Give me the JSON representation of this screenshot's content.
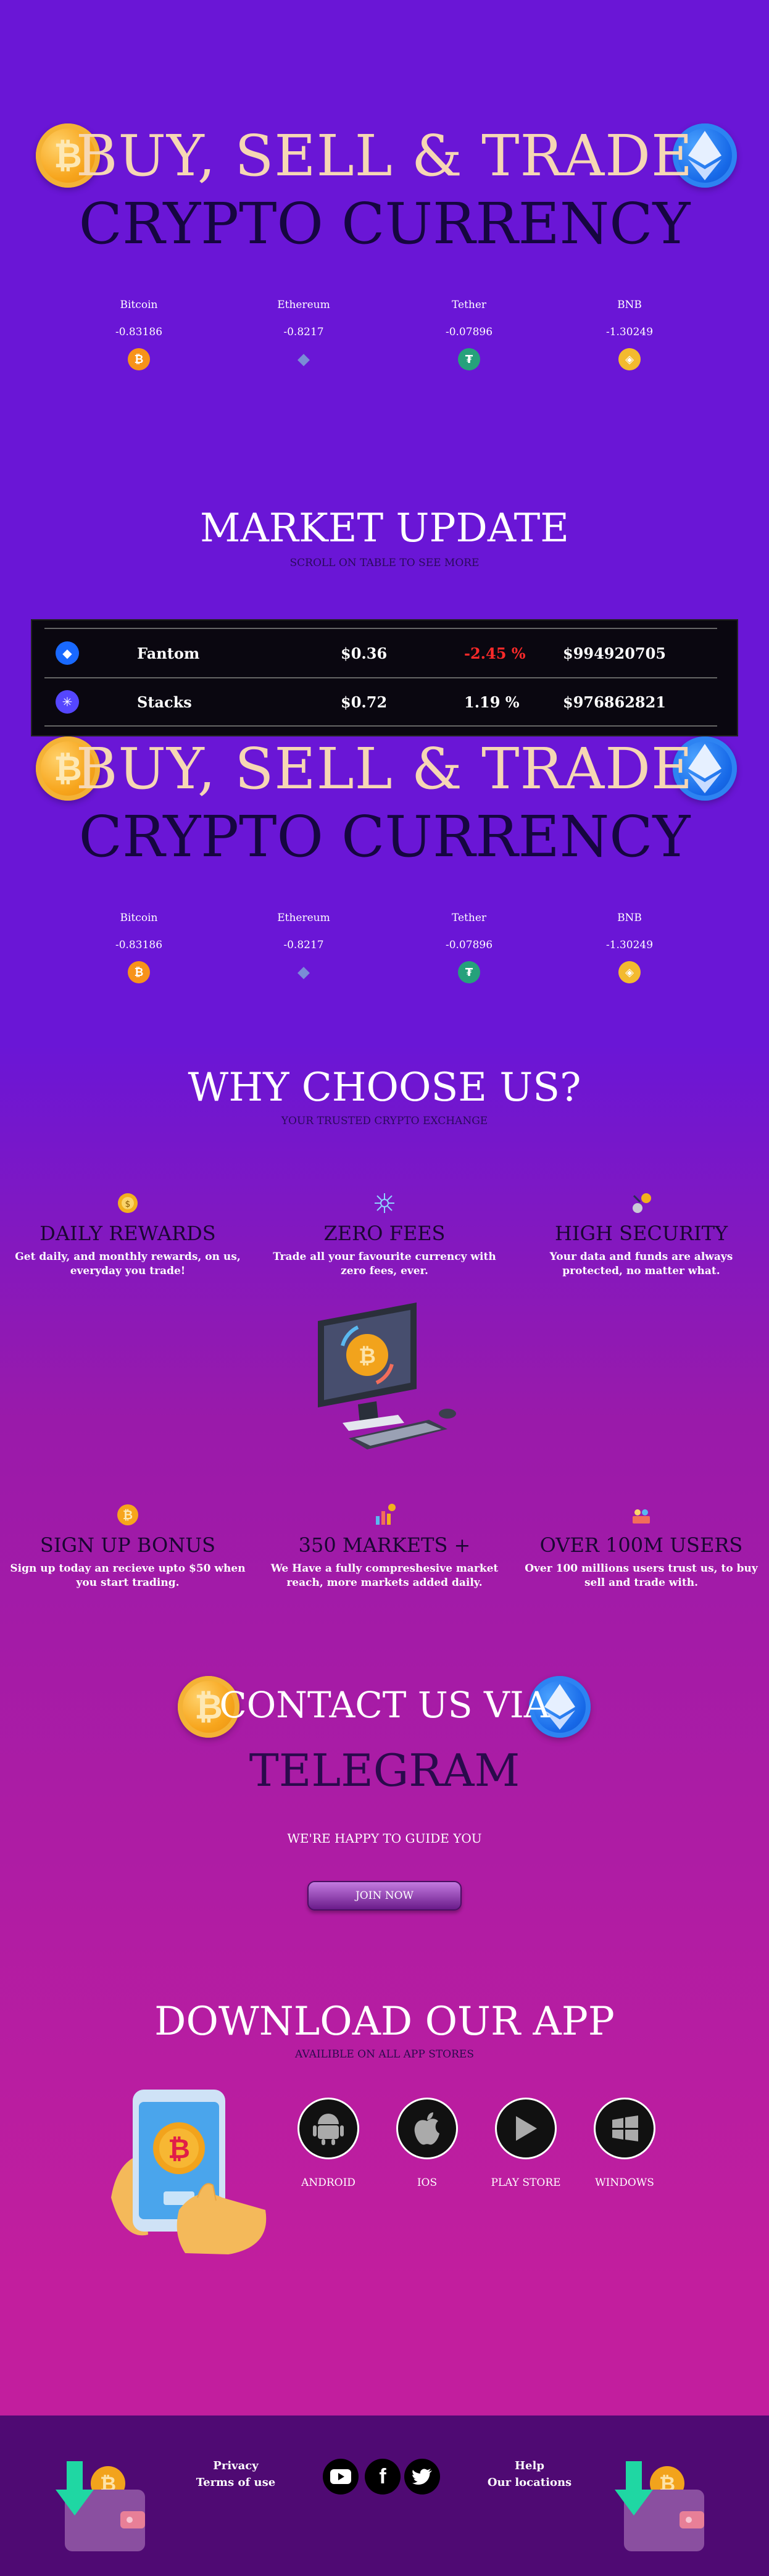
{
  "hero": {
    "title": "BUY, SELL & TRADE",
    "subtitle": "CRYPTO CURRENCY",
    "coin_left_symbol": "₿",
    "tickers": [
      {
        "name": "Bitcoin",
        "value": "-0.83186",
        "icon": "bitcoin-icon",
        "symbol": "₿",
        "color": "#f7931a"
      },
      {
        "name": "Ethereum",
        "value": "-0.8217",
        "icon": "ethereum-icon",
        "symbol": "◆",
        "color": "#627eea"
      },
      {
        "name": "Tether",
        "value": "-0.07896",
        "icon": "tether-icon",
        "symbol": "₮",
        "color": "#26a17b"
      },
      {
        "name": "BNB",
        "value": "-1.30249",
        "icon": "bnb-icon",
        "symbol": "◈",
        "color": "#f3ba2f"
      }
    ]
  },
  "market": {
    "title": "MARKET UPDATE",
    "subtitle": "SCROLL ON TABLE TO SEE MORE",
    "rows": [
      {
        "name": "Fantom",
        "price": "$0.36",
        "change": "-2.45 %",
        "volume": "$994920705",
        "icon": "fantom-icon",
        "symbol": "◆",
        "color": "#1969ff",
        "change_color": "#ff2a2a"
      },
      {
        "name": "Stacks",
        "price": "$0.72",
        "change": "1.19 %",
        "volume": "$976862821",
        "icon": "stacks-icon",
        "symbol": "✳",
        "color": "#5546ff",
        "change_color": "#ffffff"
      }
    ]
  },
  "why": {
    "title": "WHY CHOOSE US?",
    "subtitle": "YOUR TRUSTED CRYPTO EXCHANGE",
    "features": [
      {
        "title": "DAILY REWARDS",
        "desc": "Get daily, and monthly rewards, on us, everyday you trade!",
        "icon": "coin-reward-icon",
        "symbol": "💰"
      },
      {
        "title": "ZERO FEES",
        "desc": "Trade all your favourite currency with zero fees, ever.",
        "icon": "network-icon",
        "symbol": "✺"
      },
      {
        "title": "HIGH SECURITY",
        "desc": "Your data and funds are always protected, no matter what.",
        "icon": "security-icon",
        "symbol": "⚙"
      },
      {
        "title": "SIGN UP BONUS",
        "desc": "Sign up today an recieve upto $50 when you start trading.",
        "icon": "bonus-coin-icon",
        "symbol": "₿"
      },
      {
        "title": "350 MARKETS +",
        "desc": "We Have a fully compreshesive market reach, more markets added daily.",
        "icon": "markets-chart-icon",
        "symbol": "📊"
      },
      {
        "title": "OVER 100M USERS",
        "desc": "Over 100 millions users trust us, to buy sell and trade with.",
        "icon": "users-icon",
        "symbol": "👥"
      }
    ]
  },
  "contact": {
    "title": "CONTACT US VIA",
    "channel": "TELEGRAM",
    "tagline": "WE'RE HAPPY TO GUIDE YOU",
    "button": "JOIN NOW"
  },
  "app": {
    "title": "DOWNLOAD OUR APP",
    "subtitle": "AVAILIBLE ON ALL APP STORES",
    "stores": [
      {
        "label": "ANDROID",
        "icon": "android-icon"
      },
      {
        "label": "IOS",
        "icon": "apple-icon"
      },
      {
        "label": "PLAY STORE",
        "icon": "play-store-icon"
      },
      {
        "label": "WINDOWS",
        "icon": "windows-icon"
      }
    ]
  },
  "footer": {
    "privacy": "Privacy",
    "terms": "Terms of use",
    "help": "Help",
    "locations": "Our locations",
    "socials": [
      "youtube-icon",
      "facebook-icon",
      "twitter-icon"
    ],
    "facebook_glyph": "f"
  }
}
